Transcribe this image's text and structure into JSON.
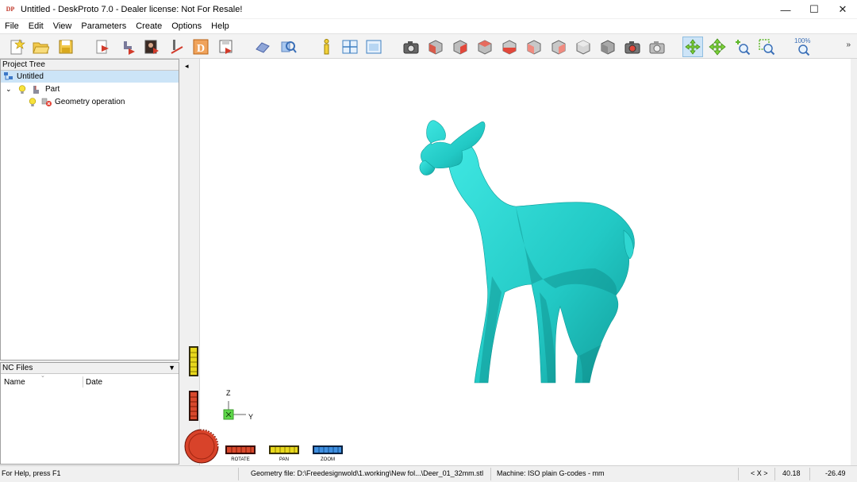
{
  "window": {
    "app_icon_text": "DP",
    "title": "Untitled - DeskProto 7.0 - Dealer license: Not For Resale!",
    "minimize": "—",
    "maximize": "☐",
    "close": "✕"
  },
  "menu": [
    "File",
    "Edit",
    "View",
    "Parameters",
    "Create",
    "Options",
    "Help"
  ],
  "toolbar": {
    "zoom_100_label": "100%",
    "more": "»"
  },
  "project_tree": {
    "header": "Project Tree",
    "root": "Untitled",
    "part": "Part",
    "operation": "Geometry operation"
  },
  "nc_files": {
    "header": "NC Files",
    "columns": [
      "Name",
      "Date"
    ]
  },
  "viewport": {
    "collapse_arrow": "◂",
    "axis_z": "Z",
    "axis_y": "Y",
    "model_color": "#25d4d0",
    "controls": {
      "rotate": "ROTATE",
      "pan": "PAN",
      "zoom": "ZOOM"
    }
  },
  "status": {
    "help": "For Help, press F1",
    "geometry_file": "Geometry file: D:\\Freedesignwold\\1.working\\New fol...\\Deer_01_32mm.stl",
    "machine": "Machine: ISO plain G-codes - mm",
    "axis": "< X >",
    "x_value": "40.18",
    "y_value": "-26.49"
  }
}
